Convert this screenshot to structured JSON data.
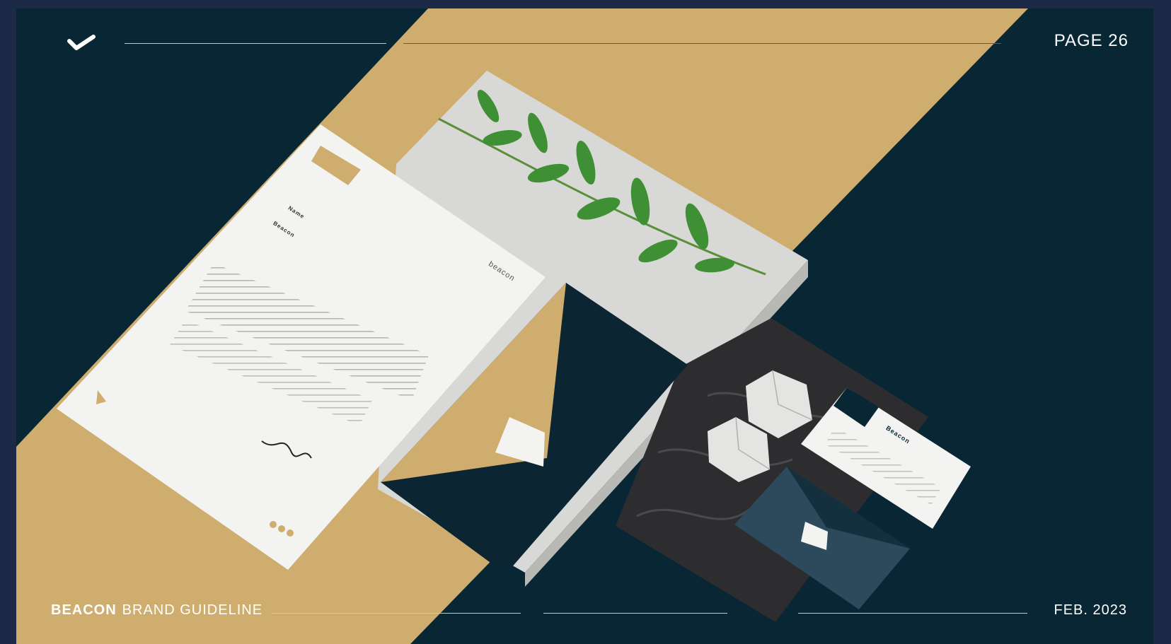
{
  "header": {
    "page_label": "PAGE 26"
  },
  "footer": {
    "brand_bold": "BEACON",
    "brand_rest": "BRAND GUIDELINE",
    "date": "FEB. 2023"
  },
  "letterhead": {
    "brand_word": "beacon",
    "recipient": "Name",
    "subject": "Beacon"
  },
  "business_card": {
    "title": "Beacon"
  },
  "colors": {
    "frame": "#1d2a47",
    "navy": "#082634",
    "gold": "#cfad6f",
    "paper": "#f3f3f1",
    "marble_light": "#d5d5d3",
    "marble_dark": "#2d2d2f",
    "leaf": "#3f8f35",
    "envelope_slate": "#2d4a5c"
  },
  "icons": {
    "logo": "check-mark-icon"
  }
}
